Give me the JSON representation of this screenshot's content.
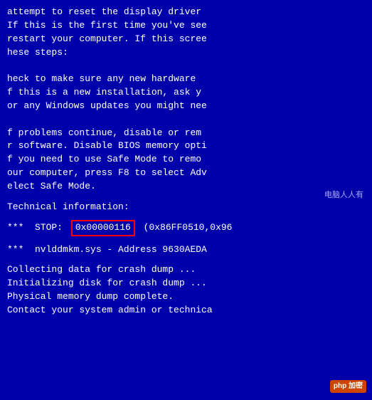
{
  "bsod": {
    "line_attempt": "attempt to reset the display driver",
    "line1": "If this is the first time you've see",
    "line2": "restart your computer. If this scree",
    "line3": "hese steps:",
    "line4": "",
    "line5": "heck to make sure any new hardware",
    "line6": "f this is a new installation, ask y",
    "line7": "or any Windows updates you might nee",
    "line8": "",
    "line9": "f problems continue, disable or rem",
    "line10": "r software. Disable BIOS memory opti",
    "line11": "f you need to use Safe Mode to remo",
    "line12": "our computer, press F8 to select Adv",
    "line13": "elect Safe Mode.",
    "watermark_cpr": "电脑人人有",
    "technical_info": "Technical information:",
    "stop_prefix": "***  STOP: ",
    "stop_code": "0x00000116",
    "stop_suffix": " (0x86FF0510,0x96",
    "driver_line": "***  nvlddmkm.sys - Address 9630AEDA",
    "line_crash1": "Collecting data for crash dump ...",
    "line_crash2": "Initializing disk for crash dump ...",
    "line_crash3": "Physical memory dump complete.",
    "line_crash4": "Contact your system admin or technica",
    "watermark_php": "php 加密"
  }
}
